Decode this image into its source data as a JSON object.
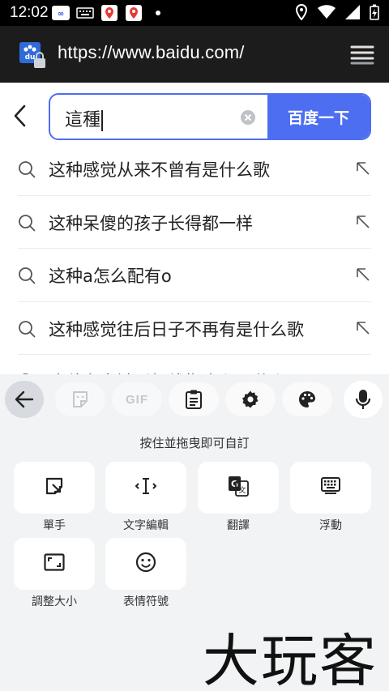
{
  "status_bar": {
    "time": "12:02",
    "icons_left": [
      "baidu-app-icon",
      "keyboard-icon",
      "maps-pin-icon",
      "maps-pin-icon",
      "dot-icon"
    ],
    "icons_right": [
      "location-icon",
      "wifi-icon",
      "signal-icon",
      "battery-charging-icon"
    ]
  },
  "browser": {
    "url": "https://www.baidu.com/",
    "site_icon": "baidu-paw-icon",
    "menu_icon": "tabs-menu-icon"
  },
  "search": {
    "query": "這種",
    "button_label": "百度一下"
  },
  "suggestions": [
    "这种感觉从来不曾有是什么歌",
    "这种呆傻的孩子长得都一样",
    "这种a怎么配有o",
    "这种感觉往后日子不再有是什么歌",
    "这种东多链形标线指令兴是什么?"
  ],
  "keyboard": {
    "toolbar": [
      "back-arrow-icon",
      "sticker-icon",
      "gif-icon",
      "clipboard-icon",
      "settings-icon",
      "palette-icon",
      "mic-icon"
    ],
    "gif_label": "GIF",
    "hint": "按住並拖曳即可自訂",
    "tiles": [
      {
        "label": "單手",
        "icon": "one-handed-icon"
      },
      {
        "label": "文字編輯",
        "icon": "text-cursor-icon"
      },
      {
        "label": "翻譯",
        "icon": "translate-icon"
      },
      {
        "label": "浮動",
        "icon": "floating-keyboard-icon"
      },
      {
        "label": "調整大小",
        "icon": "resize-icon"
      },
      {
        "label": "表情符號",
        "icon": "emoji-icon"
      }
    ]
  },
  "watermark": "大玩客"
}
